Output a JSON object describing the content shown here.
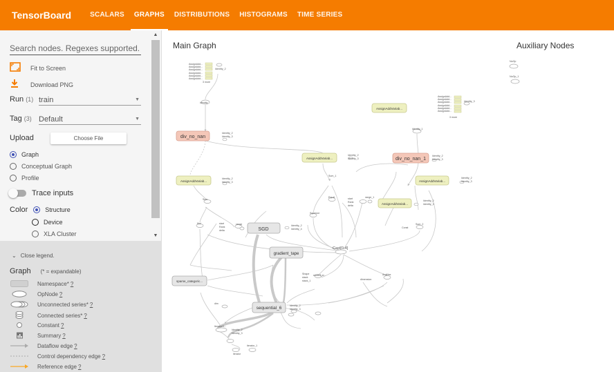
{
  "app": {
    "title": "TensorBoard"
  },
  "tabs": [
    {
      "label": "SCALARS",
      "active": false
    },
    {
      "label": "GRAPHS",
      "active": true
    },
    {
      "label": "DISTRIBUTIONS",
      "active": false
    },
    {
      "label": "HISTOGRAMS",
      "active": false
    },
    {
      "label": "TIME SERIES",
      "active": false
    }
  ],
  "sidebar": {
    "search_placeholder": "Search nodes. Regexes supported.",
    "fit_label": "Fit to Screen",
    "download_label": "Download PNG",
    "run": {
      "label": "Run",
      "count": "(1)",
      "value": "train"
    },
    "tag": {
      "label": "Tag",
      "count": "(3)",
      "value": "Default"
    },
    "upload": {
      "label": "Upload",
      "button": "Choose File"
    },
    "graph_type": [
      {
        "label": "Graph",
        "selected": true
      },
      {
        "label": "Conceptual Graph",
        "selected": false
      },
      {
        "label": "Profile",
        "selected": false
      }
    ],
    "trace_inputs": "Trace inputs",
    "color": {
      "label": "Color",
      "options": [
        {
          "label": "Structure",
          "selected": true
        },
        {
          "label": "Device",
          "selected": false
        },
        {
          "label": "XLA Cluster",
          "selected": false
        }
      ]
    }
  },
  "legend": {
    "close_label": "Close legend.",
    "title": "Graph",
    "subtitle": "(* = expandable)",
    "items": [
      {
        "label": "Namespace*",
        "help": "?"
      },
      {
        "label": "OpNode",
        "help": "?"
      },
      {
        "label": "Unconnected series*",
        "help": "?"
      },
      {
        "label": "Connected series*",
        "help": "?"
      },
      {
        "label": "Constant",
        "help": "?"
      },
      {
        "label": "Summary",
        "help": "?"
      },
      {
        "label": "Dataflow edge",
        "help": "?"
      },
      {
        "label": "Control dependency edge",
        "help": "?"
      },
      {
        "label": "Reference edge",
        "help": "?"
      }
    ]
  },
  "graph": {
    "main_title": "Main Graph",
    "aux_title": "Auxiliary Nodes",
    "nodes": {
      "div_no_nan": "div_no_nan",
      "div_no_nan_1": "div_no_nan_1",
      "sgd": "SGD",
      "gradient_tape": "gradient_tape",
      "sequential": "sequential_6",
      "cast": "Cast[0-4]",
      "sparse": "sparse_categoric...",
      "assign_a": "AssignAddVariab...",
      "assign_b": "AssignAddVariab...",
      "assign_c": "AssignAddVariab...",
      "assign_d": "AssignAddVariab...",
      "assign_e": "AssignAddVariab...",
      "identity": "identity",
      "identity_1": "identity_1",
      "identity_top": "Identity_2",
      "identity_top_r": "Identity_3",
      "sum": "Sum",
      "sum_1": "Sum_1",
      "sum_2": "Sum_2",
      "mul": "Mul",
      "equal": "Equal",
      "squeeze": "Squeeze",
      "range": "range",
      "range_1": "range_1",
      "argmax": "ArgMax",
      "dimension": "dimension",
      "shape": "Shape",
      "strided": "strided_sl...",
      "iterator": "IteratorG...",
      "iterator_1": "iterator",
      "iterator_2": "iterator_1",
      "aux_1": "NoOp",
      "aux_2": "NoOp_1",
      "assign_list": "AssignAdd...",
      "more": "3 more",
      "lbl_identity2": "Identity_2",
      "lbl_identity3": "Identity_3",
      "lbl_identity4": "Identity_4",
      "lbl_start": "start",
      "lbl_rank": "Rank",
      "lbl_delta": "delta",
      "lbl_const": "Const",
      "lbl_dim": "dim",
      "lbl_shape": "Shape",
      "lbl_stack": "stack",
      "lbl_stack1": "stack_1"
    }
  },
  "colors": {
    "accent": "#f57c00",
    "radio": "#3f51b5",
    "namespace_red": "#f4c7b8",
    "namespace_yellow": "#eef0c0"
  }
}
